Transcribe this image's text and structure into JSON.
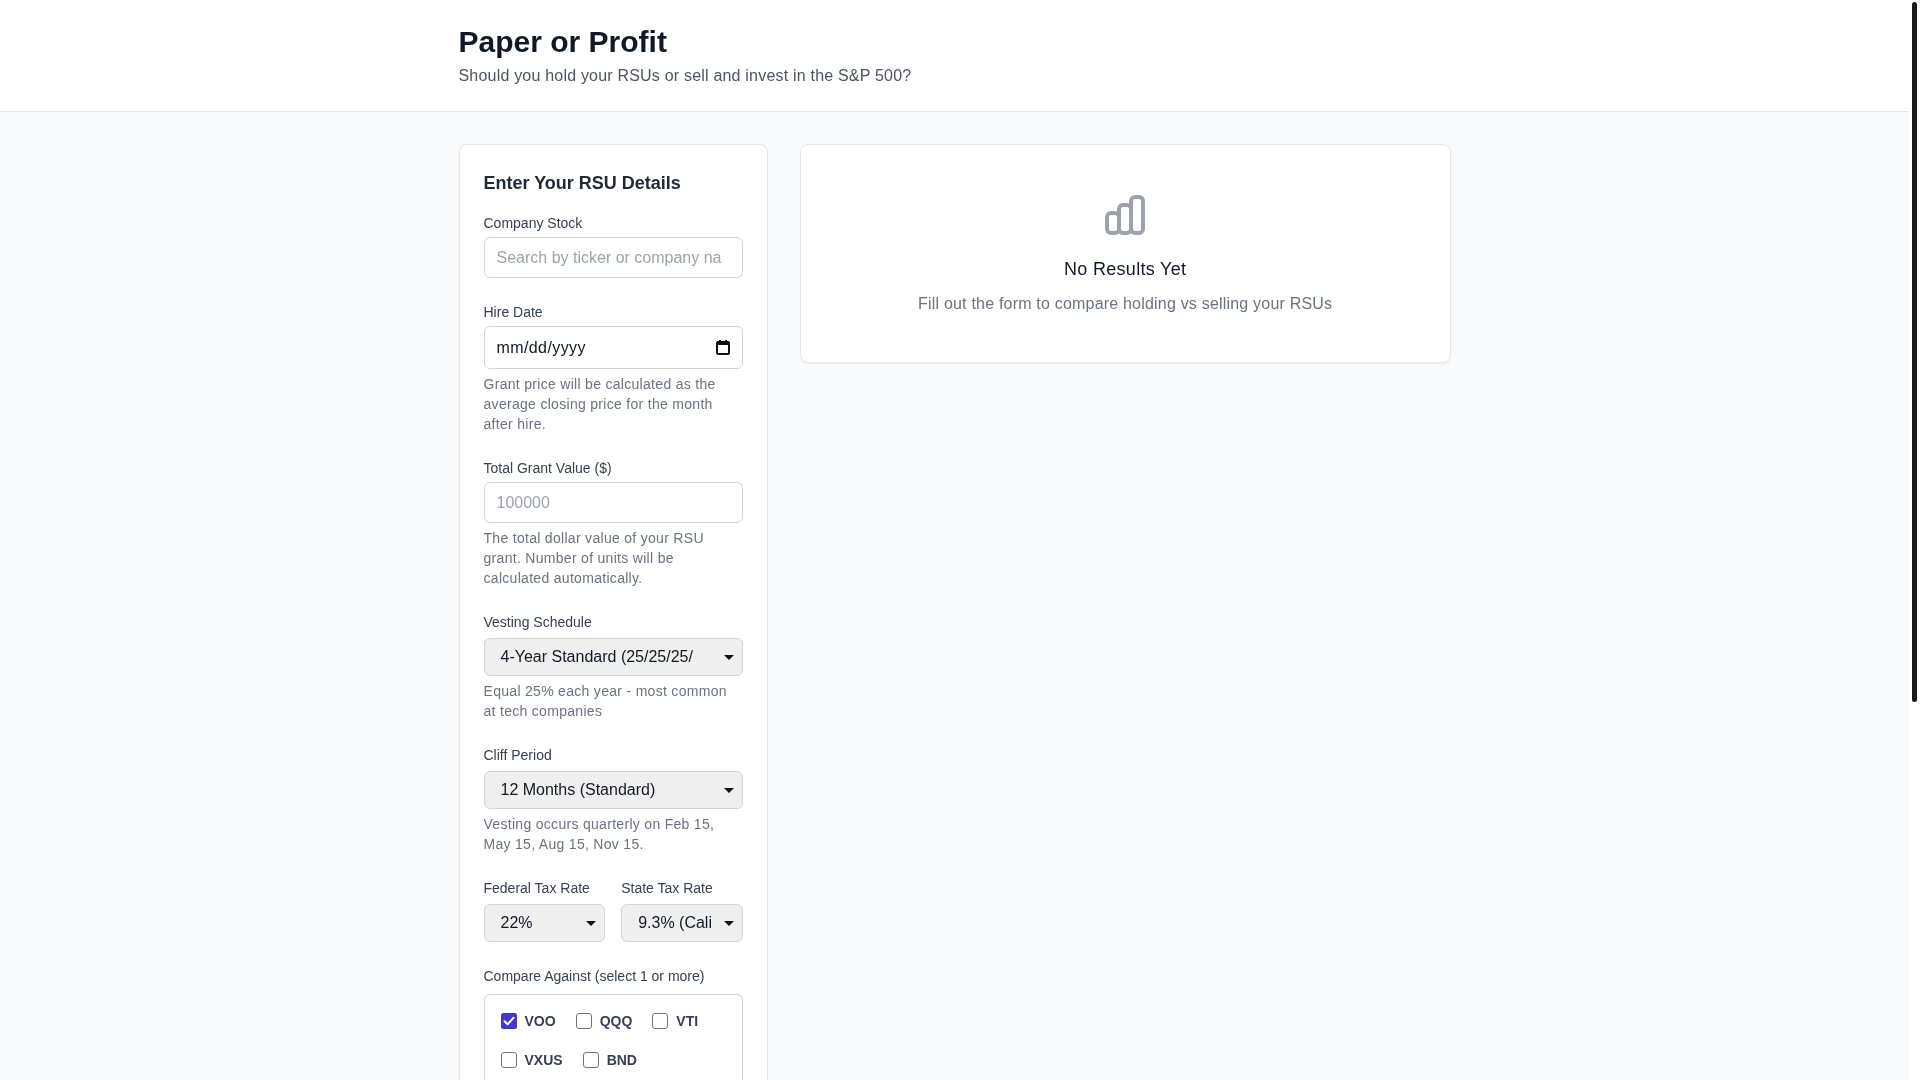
{
  "header": {
    "title": "Paper or Profit",
    "subtitle": "Should you hold your RSUs or sell and invest in the S&P 500?"
  },
  "form": {
    "title": "Enter Your RSU Details",
    "fields": [
      {
        "kind": "text",
        "label": "Company Stock",
        "placeholder": "Search by ticker or company na"
      },
      {
        "kind": "date",
        "label": "Hire Date",
        "placeholder": "mm/dd/yyyy",
        "help": "Grant price will be calculated as the average closing price for the month after hire."
      },
      {
        "kind": "text",
        "label": "Total Grant Value ($)",
        "placeholder": "100000",
        "help": "The total dollar value of your RSU grant. Number of units will be calculated automatically."
      },
      {
        "kind": "select",
        "label": "Vesting Schedule",
        "value": "4-Year Standard (25/25/25/",
        "help": "Equal 25% each year - most common at tech companies"
      },
      {
        "kind": "select",
        "label": "Cliff Period",
        "value": "12 Months (Standard)",
        "help": "Vesting occurs quarterly on Feb 15, May 15, Aug 15, Nov 15."
      },
      {
        "kind": "pair",
        "items": [
          {
            "kind": "select",
            "label": "Federal Tax Rate",
            "value": "22%"
          },
          {
            "kind": "select",
            "label": "State Tax Rate",
            "value": "9.3% (Cali"
          }
        ]
      },
      {
        "kind": "checkboxes",
        "label": "Compare Against (select 1 or more)",
        "options": [
          {
            "label": "VOO",
            "checked": true
          },
          {
            "label": "QQQ",
            "checked": false
          },
          {
            "label": "VTI",
            "checked": false
          },
          {
            "label": "VXUS",
            "checked": false
          },
          {
            "label": "BND",
            "checked": false
          }
        ]
      }
    ]
  },
  "results": {
    "title": "No Results Yet",
    "message": "Fill out the form to compare holding vs selling your RSUs"
  }
}
